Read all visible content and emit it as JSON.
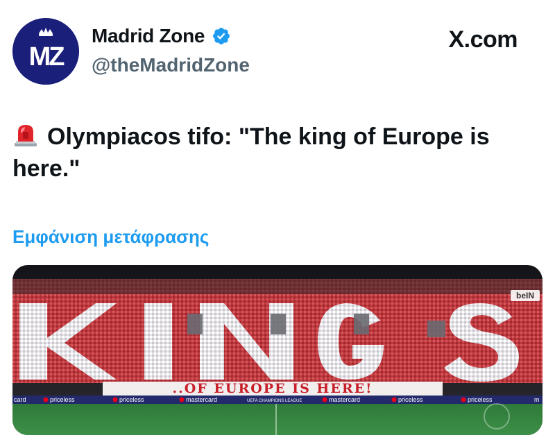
{
  "tweet": {
    "author_name": "Madrid Zone",
    "author_handle": "@theMadridZone",
    "avatar_initials": "MZ",
    "verified": true,
    "source_label": "X.com",
    "text": "Olympiacos tifo: \"The king of Europe is here.\"",
    "text_icon": "rotating-light-icon",
    "translate_label": "Εμφάνιση μετάφρασης"
  },
  "media": {
    "banner_text": "..OF EUROPE IS HERE!",
    "broadcaster_logo": "beIN",
    "ad_boards": [
      "card",
      "priceless",
      "priceless",
      "mastercard",
      "UEFA CHAMPIONS LEAGUE",
      "mastercard",
      "priceless",
      "priceless",
      "m"
    ]
  },
  "colors": {
    "accent": "#1d9bf0",
    "text": "#0f1419",
    "secondary": "#536471",
    "avatar_bg": "#1a1f7a"
  }
}
